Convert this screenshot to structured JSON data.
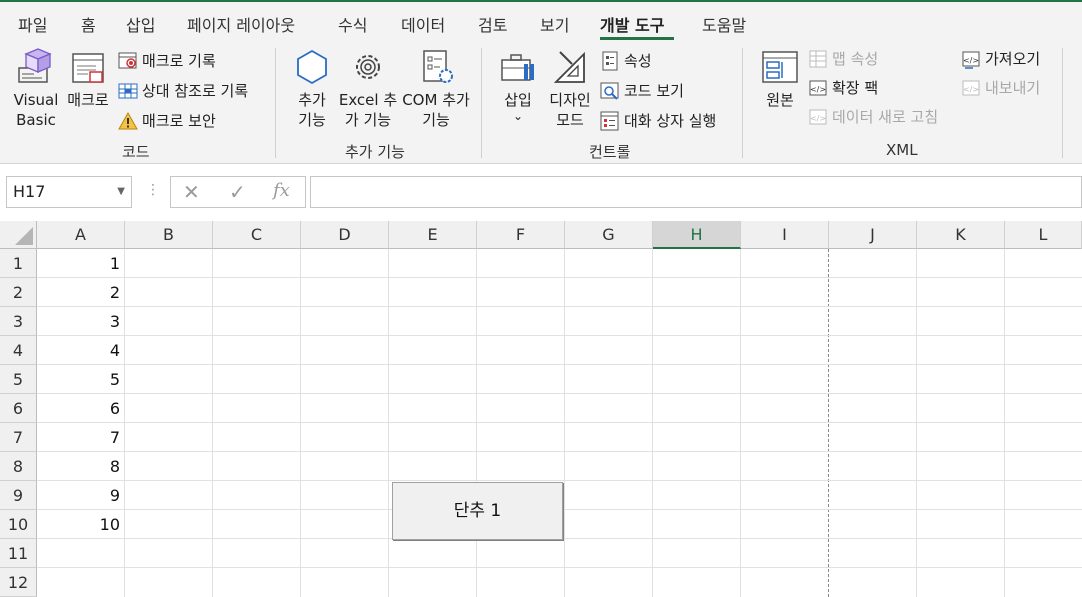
{
  "ribbon": {
    "tabs": [
      "파일",
      "홈",
      "삽입",
      "페이지 레이아웃",
      "수식",
      "데이터",
      "검토",
      "보기",
      "개발 도구",
      "도움말"
    ],
    "active_tab": "개발 도구",
    "groups": {
      "code": {
        "label": "코드",
        "visual_basic": "Visual Basic",
        "macros": "매크로",
        "record_macro": "매크로 기록",
        "relative_ref": "상대 참조로 기록",
        "macro_security": "매크로 보안"
      },
      "addins": {
        "label": "추가 기능",
        "addins": "추가 기능",
        "excel_addins": "Excel 추가 기능",
        "com_addins": "COM 추가 기능"
      },
      "controls": {
        "label": "컨트롤",
        "insert": "삽입",
        "design_mode": "디자인 모드",
        "properties": "속성",
        "view_code": "코드 보기",
        "run_dialog": "대화 상자 실행"
      },
      "xml": {
        "label": "XML",
        "source": "원본",
        "map_properties": "맵 속성",
        "expansion_packs": "확장 팩",
        "refresh_data": "데이터 새로 고침",
        "import": "가져오기",
        "export": "내보내기"
      }
    }
  },
  "formula_bar": {
    "name_box": "H17",
    "cancel_symbol": "✕",
    "enter_symbol": "✓",
    "fx_label": "fx",
    "formula": ""
  },
  "sheet": {
    "columns": [
      "A",
      "B",
      "C",
      "D",
      "E",
      "F",
      "G",
      "H",
      "I",
      "J",
      "K",
      "L"
    ],
    "selected_column": "H",
    "rows": [
      "1",
      "2",
      "3",
      "4",
      "5",
      "6",
      "7",
      "8",
      "9",
      "10",
      "11",
      "12"
    ],
    "column_a_values": [
      "1",
      "2",
      "3",
      "4",
      "5",
      "6",
      "7",
      "8",
      "9",
      "10"
    ],
    "form_button_label": "단추 1"
  },
  "colors": {
    "accent": "#217346",
    "ribbon_bg": "#f3f3f3"
  }
}
